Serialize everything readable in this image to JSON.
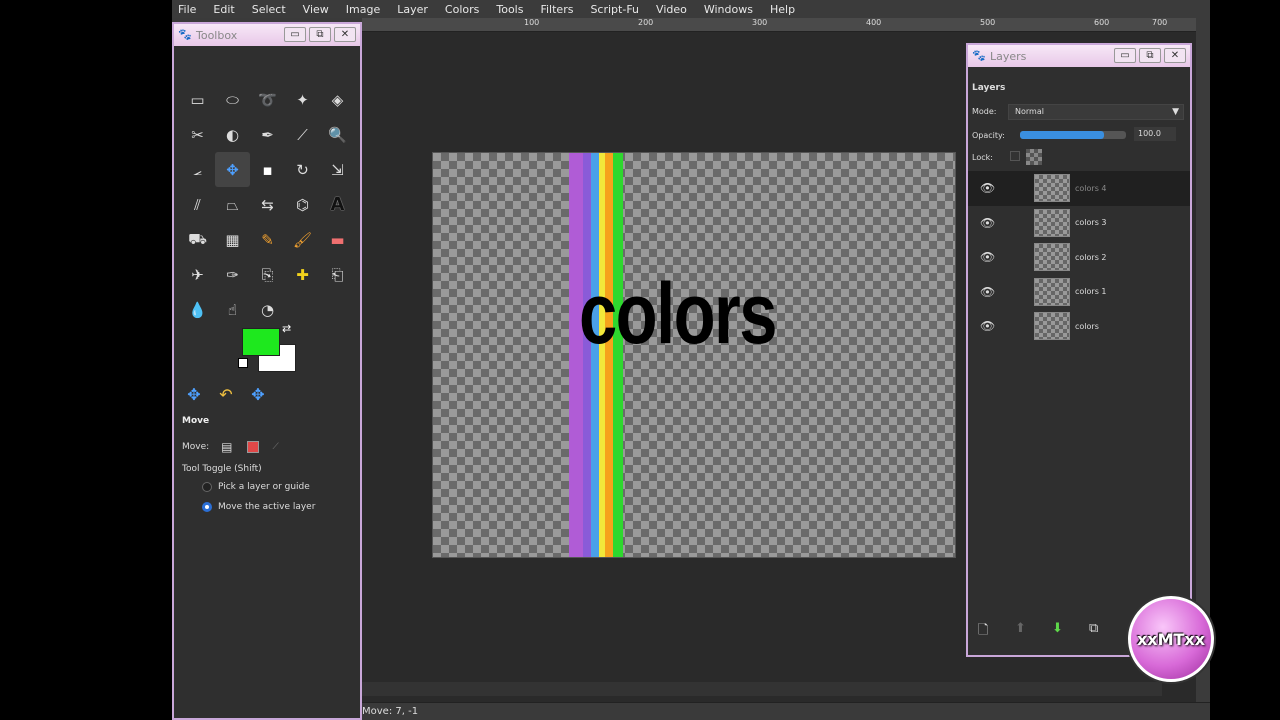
{
  "menu": [
    "File",
    "Edit",
    "Select",
    "View",
    "Image",
    "Layer",
    "Colors",
    "Tools",
    "Filters",
    "Script-Fu",
    "Video",
    "Windows",
    "Help"
  ],
  "ruler_ticks": [
    "100",
    "200",
    "300",
    "400",
    "500",
    "600",
    "700"
  ],
  "toolbox": {
    "title": "Toolbox",
    "buttons": {
      "minimize": "▭",
      "maximize": "⧉",
      "close": "✕"
    },
    "tools": [
      "rect-select-icon",
      "ellipse-select-icon",
      "lasso-icon",
      "fuzzy-select-icon",
      "color-select-icon",
      "scissors-icon",
      "foreground-select-icon",
      "paths-icon",
      "color-picker-icon",
      "zoom-icon",
      "measure-icon",
      "move-icon",
      "crop-icon",
      "rotate-icon",
      "scale-icon",
      "shear-icon",
      "perspective-icon",
      "flip-icon",
      "cage-icon",
      "text-icon",
      "bucket-fill-icon",
      "blend-icon",
      "pencil-icon",
      "paintbrush-icon",
      "eraser-icon",
      "airbrush-icon",
      "ink-icon",
      "clone-icon",
      "heal-icon",
      "perspective-clone-icon",
      "blur-icon",
      "smudge-icon",
      "dodge-icon"
    ],
    "fg_color": "#1ee81e",
    "bg_color": "#ffffff",
    "options": {
      "title": "Move",
      "move_label": "Move:",
      "toggle_label": "Tool Toggle  (Shift)",
      "radio1": "Pick a layer or guide",
      "radio2": "Move the active layer"
    }
  },
  "canvas": {
    "text": "colors",
    "stripes": [
      "#b05cd6",
      "#8a5bd8",
      "#4aa0e8",
      "#f2e83a",
      "#f6a21c",
      "#2ed82e"
    ]
  },
  "layers": {
    "title": "Layers",
    "section": "Layers",
    "mode_label": "Mode:",
    "mode_value": "Normal",
    "opacity_label": "Opacity:",
    "opacity_value": "100.0",
    "lock_label": "Lock:",
    "items": [
      {
        "name": "colors 4",
        "selected": true
      },
      {
        "name": "colors 3",
        "selected": false
      },
      {
        "name": "colors 2",
        "selected": false
      },
      {
        "name": "colors 1",
        "selected": false
      },
      {
        "name": "colors",
        "selected": false
      }
    ]
  },
  "status": "Move: 7, -1",
  "watermark": "xxMTxx"
}
